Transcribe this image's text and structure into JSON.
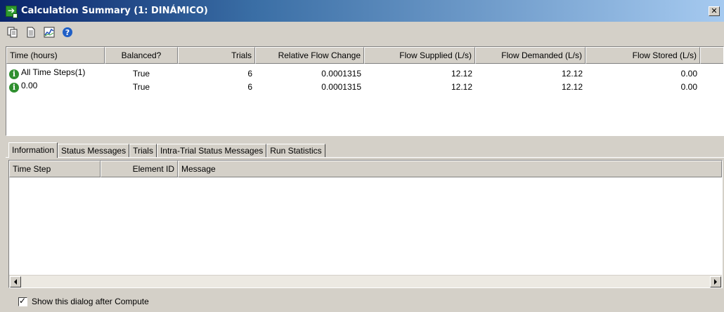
{
  "window": {
    "title": "Calculation Summary (1: DINÁMICO)",
    "close_glyph": "✕"
  },
  "toolbar": {
    "icons": [
      "copy-icon",
      "report-icon",
      "graph-icon",
      "help-icon"
    ]
  },
  "summary_table": {
    "columns": [
      "Time (hours)",
      "Balanced?",
      "Trials",
      "Relative Flow Change",
      "Flow Supplied (L/s)",
      "Flow Demanded (L/s)",
      "Flow Stored (L/s)"
    ],
    "rows": [
      {
        "time": "All Time Steps(1)",
        "balanced": "True",
        "trials": "6",
        "relative_flow_change": "0.0001315",
        "flow_supplied": "12.12",
        "flow_demanded": "12.12",
        "flow_stored": "0.00"
      },
      {
        "time": "0.00",
        "balanced": "True",
        "trials": "6",
        "relative_flow_change": "0.0001315",
        "flow_supplied": "12.12",
        "flow_demanded": "12.12",
        "flow_stored": "0.00"
      }
    ]
  },
  "tabs": [
    "Information",
    "Status Messages",
    "Trials",
    "Intra-Trial Status Messages",
    "Run Statistics"
  ],
  "active_tab": "Information",
  "messages_table": {
    "columns": [
      "Time Step",
      "Element ID",
      "Message"
    ]
  },
  "footer": {
    "checkbox_label": "Show this dialog after Compute",
    "checked": true
  },
  "colors": {
    "info_icon": "#2f8f2f",
    "title_bar_start": "#0a246a",
    "dialog_bg": "#d4d0c8"
  }
}
